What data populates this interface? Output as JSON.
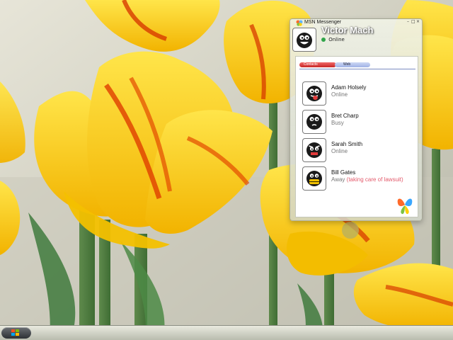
{
  "window": {
    "title": "MSN Messenger"
  },
  "user": {
    "name": "Victor Mach",
    "status": "Online"
  },
  "tabs": [
    {
      "label": "Contacts"
    },
    {
      "label": "Web"
    }
  ],
  "contacts": [
    {
      "name": "Adam Holsely",
      "status": "Online",
      "personal_message": ""
    },
    {
      "name": "Bret Charp",
      "status": "Busy",
      "personal_message": ""
    },
    {
      "name": "Sarah Smith",
      "status": "Online",
      "personal_message": ""
    },
    {
      "name": "Bill Gates",
      "status": "Away",
      "personal_message": "(taking care of lawsuit)"
    }
  ],
  "colors": {
    "status_online": "#31a54a",
    "personal_message": "#e35a6b",
    "tab_active": "#c82626"
  },
  "icons": [
    "windows-start-icon",
    "msn-butterfly-icon",
    "online-status-icon",
    "minimize-icon",
    "maximize-icon",
    "close-icon"
  ]
}
